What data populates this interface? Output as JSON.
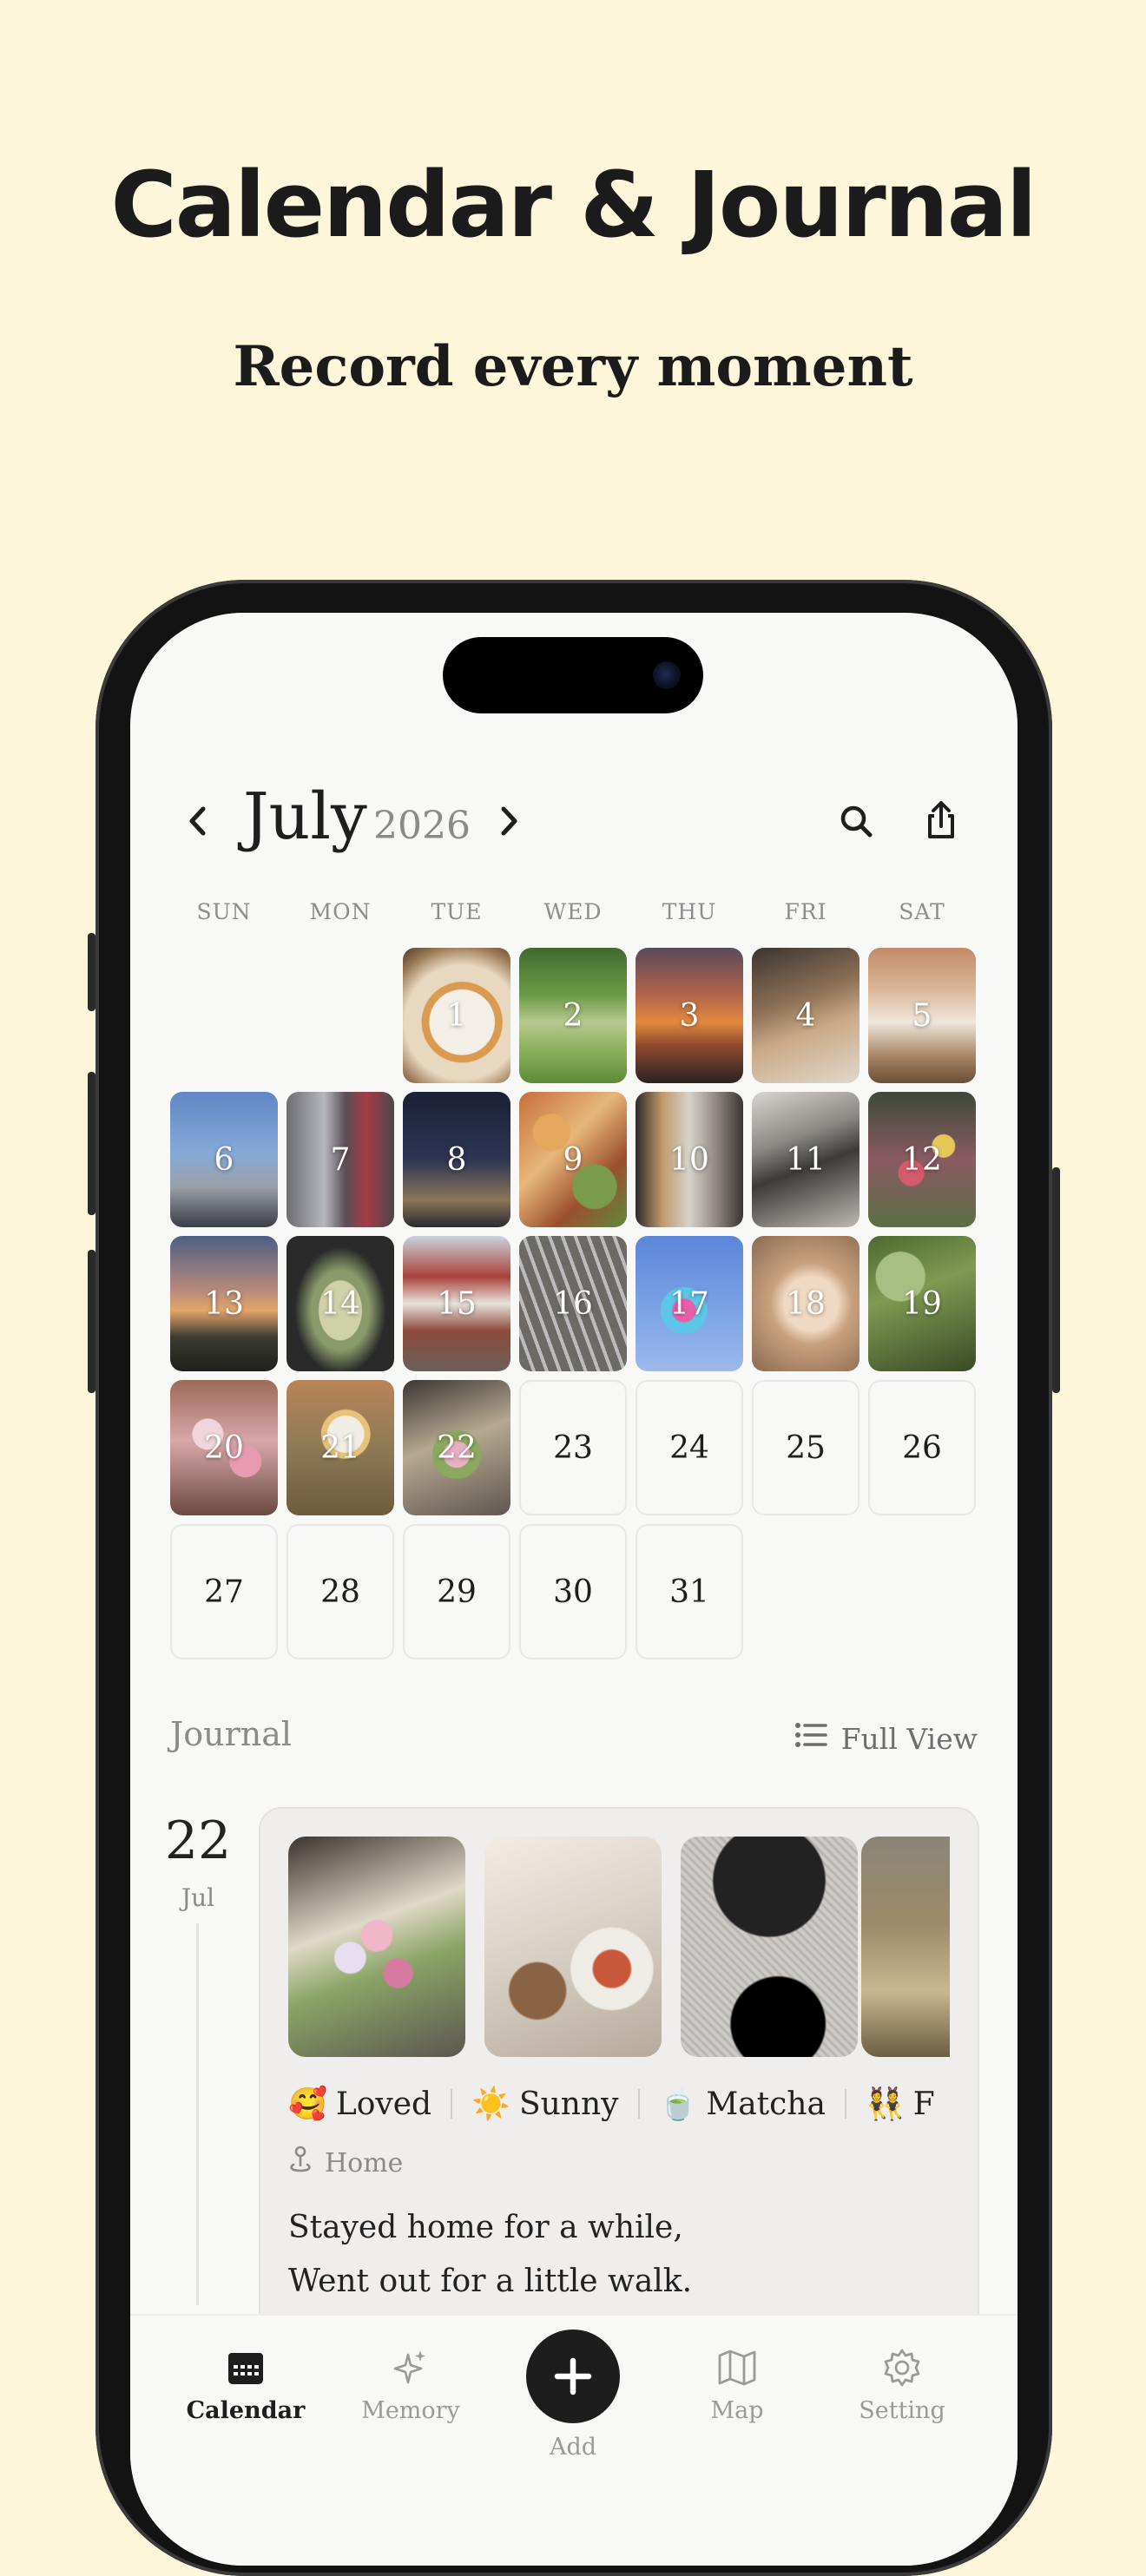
{
  "promo": {
    "headline": "Calendar & Journal",
    "subheadline": "Record every moment"
  },
  "calendar": {
    "month": "July",
    "year": "2026",
    "prev_icon": "chevron-left-icon",
    "next_icon": "chevron-right-icon",
    "search_icon": "search-icon",
    "share_icon": "share-icon",
    "weekdays": [
      "SUN",
      "MON",
      "TUE",
      "WED",
      "THU",
      "FRI",
      "SAT"
    ],
    "days": [
      "1",
      "2",
      "3",
      "4",
      "5",
      "6",
      "7",
      "8",
      "9",
      "10",
      "11",
      "12",
      "13",
      "14",
      "15",
      "16",
      "17",
      "18",
      "19",
      "20",
      "21",
      "22",
      "23",
      "24",
      "25",
      "26",
      "27",
      "28",
      "29",
      "30",
      "31"
    ]
  },
  "journal": {
    "title": "Journal",
    "full_view_label": "Full View",
    "entry": {
      "day": "22",
      "month": "Jul",
      "tags": [
        {
          "emoji": "🥰",
          "label": "Loved"
        },
        {
          "emoji": "☀️",
          "label": "Sunny"
        },
        {
          "emoji": "🍵",
          "label": "Matcha"
        },
        {
          "emoji": "👯",
          "label": "F"
        }
      ],
      "place": "Home",
      "text_line1": "Stayed home for a while,",
      "text_line2": "Went out for a little walk."
    }
  },
  "tabbar": {
    "calendar": "Calendar",
    "memory": "Memory",
    "add": "Add",
    "map": "Map",
    "setting": "Setting"
  },
  "colors": {
    "background": "#FEF6DA",
    "screen": "#F8F8F7",
    "accent": "#1d1d1d"
  }
}
